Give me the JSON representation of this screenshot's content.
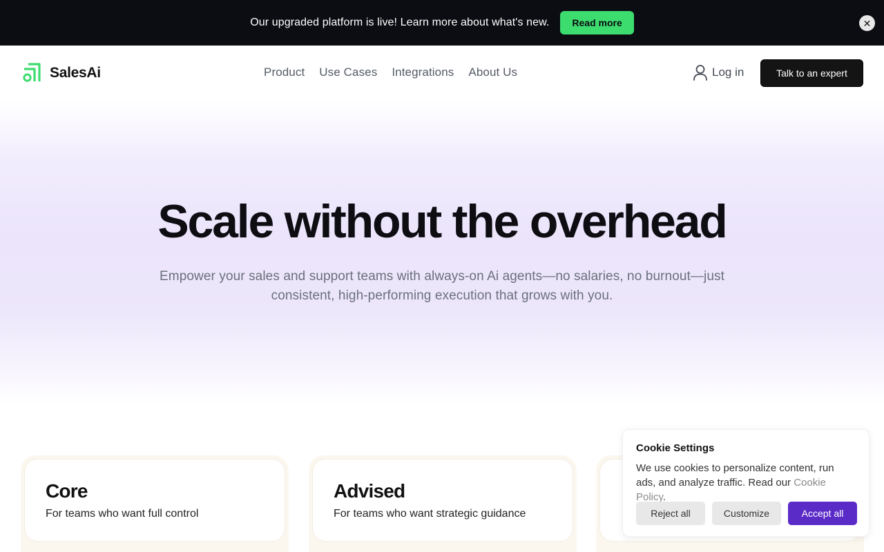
{
  "announcement": {
    "text": "Our upgraded platform is live! Learn more about what's new.",
    "button_label": "Read more",
    "close_symbol": "✕"
  },
  "header": {
    "brand": "SalesAi",
    "nav": [
      "Product",
      "Use Cases",
      "Integrations",
      "About Us"
    ],
    "login_label": "Log in",
    "cta_label": "Talk to an expert"
  },
  "hero": {
    "title": "Scale without the overhead",
    "subtitle": "Empower your sales and support teams with always-on Ai agents—no salaries, no burnout—just consistent, high-performing execution that grows with you."
  },
  "plans": [
    {
      "title": "Core",
      "description": "For teams who want full control"
    },
    {
      "title": "Advised",
      "description": "For teams who want strategic guidance"
    },
    {
      "title": "",
      "description": ""
    }
  ],
  "cookie": {
    "title": "Cookie Settings",
    "text_before_link": "We use cookies to personalize content, run ads, and analyze traffic. Read our ",
    "link_label": "Cookie Policy",
    "text_after_link": ".",
    "reject_label": "Reject all",
    "customize_label": "Customize",
    "accept_label": "Accept all"
  },
  "colors": {
    "brand_green": "#3ddc6f",
    "accent_purple": "#5b2bc8",
    "banner_bg": "#0b0d12"
  },
  "icons": {
    "logo": "salesai-logo-icon",
    "login": "user-icon",
    "close": "close-icon"
  }
}
